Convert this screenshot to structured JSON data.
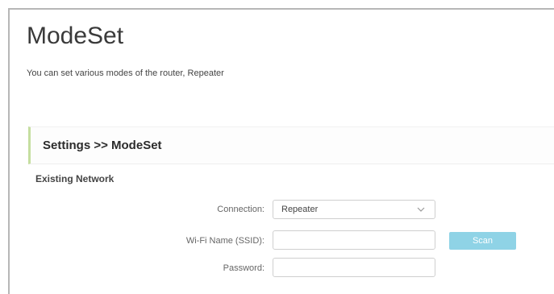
{
  "page": {
    "title": "ModeSet",
    "description": "You can set various modes of the router, Repeater"
  },
  "section": {
    "title": "Settings >> ModeSet",
    "accent_color": "#c5dea0"
  },
  "existing_network": {
    "title": "Existing Network",
    "connection": {
      "label": "Connection:",
      "value": "Repeater",
      "icon": "chevron-down-icon"
    },
    "ssid": {
      "label": "Wi-Fi Name (SSID):",
      "value": ""
    },
    "scan": {
      "label": "Scan",
      "color": "#8fd3e6"
    },
    "password": {
      "label": "Password:",
      "value": ""
    }
  }
}
